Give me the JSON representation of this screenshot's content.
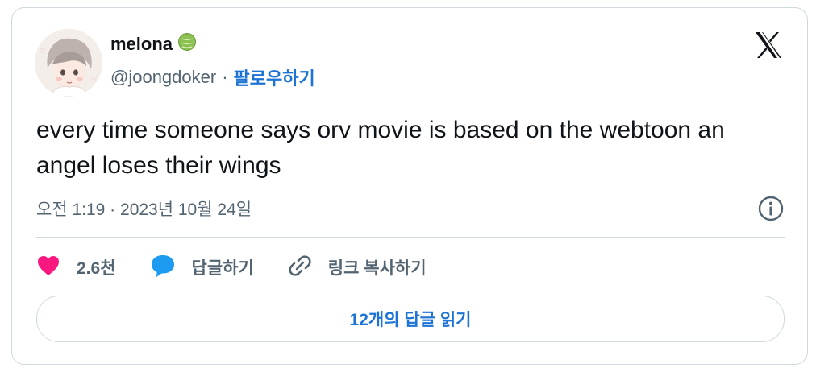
{
  "author": {
    "name": "melona",
    "handle": "@joongdoker",
    "separator": "·",
    "follow_label": "팔로우하기",
    "name_emoji_icon": "melon-icon",
    "avatar_icon": "avatar-illustration"
  },
  "brand": {
    "logo": "x-logo-icon"
  },
  "tweet": {
    "text": "every time someone says orv movie is based on the webtoon an angel loses their wings"
  },
  "meta": {
    "timestamp": "오전 1:19 · 2023년 10월 24일",
    "info_icon": "info-icon"
  },
  "actions": {
    "like_count": "2.6천",
    "reply_label": "답글하기",
    "copy_link_label": "링크 복사하기",
    "like_icon": "heart-icon",
    "reply_icon": "speech-bubble-icon",
    "link_icon": "link-icon"
  },
  "read_replies_label": "12개의 답글 읽기",
  "colors": {
    "accent": "#1d74d4",
    "secondary_text": "#536471",
    "border": "#cfd9de",
    "heart": "#f91880",
    "reply_bubble": "#1d9bf0"
  }
}
